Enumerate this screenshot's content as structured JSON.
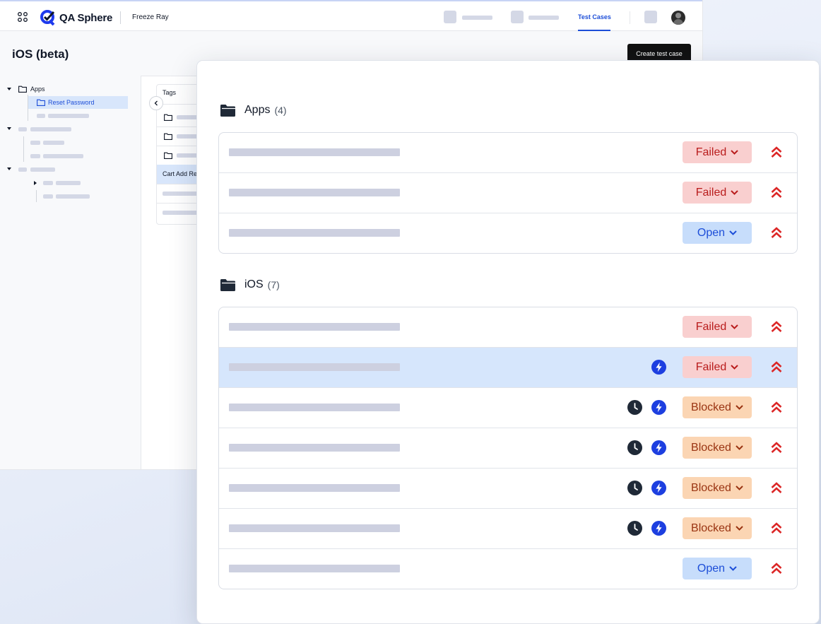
{
  "app": {
    "logo_text": "QA Sphere",
    "project_name": "Freeze Ray",
    "nav_active": "Test Cases",
    "page_title": "iOS (beta)",
    "create_button": "Create test case"
  },
  "sidebar": {
    "root_folder": "Apps",
    "selected_folder": "Reset Password"
  },
  "mid_panel": {
    "tab": "Tags",
    "row_text": "Cart Add Re"
  },
  "groups": [
    {
      "name": "Apps",
      "count": "(4)",
      "rows": [
        {
          "status": "Failed",
          "kind": "failed",
          "clock": false,
          "bolt": false,
          "highlight": false
        },
        {
          "status": "Failed",
          "kind": "failed",
          "clock": false,
          "bolt": false,
          "highlight": false
        },
        {
          "status": "Open",
          "kind": "open",
          "clock": false,
          "bolt": false,
          "highlight": false
        }
      ]
    },
    {
      "name": "iOS",
      "count": "(7)",
      "rows": [
        {
          "status": "Failed",
          "kind": "failed",
          "clock": false,
          "bolt": false,
          "highlight": false
        },
        {
          "status": "Failed",
          "kind": "failed",
          "clock": false,
          "bolt": true,
          "highlight": true
        },
        {
          "status": "Blocked",
          "kind": "blocked",
          "clock": true,
          "bolt": true,
          "highlight": false
        },
        {
          "status": "Blocked",
          "kind": "blocked",
          "clock": true,
          "bolt": true,
          "highlight": false
        },
        {
          "status": "Blocked",
          "kind": "blocked",
          "clock": true,
          "bolt": true,
          "highlight": false
        },
        {
          "status": "Blocked",
          "kind": "blocked",
          "clock": true,
          "bolt": true,
          "highlight": false
        },
        {
          "status": "Open",
          "kind": "open",
          "clock": false,
          "bolt": false,
          "highlight": false
        }
      ]
    }
  ],
  "icons": {
    "folder": "folder-icon",
    "clock": "clock-icon",
    "bolt": "lightning-icon",
    "priority": "priority-high-icon",
    "chevron": "chevron-down-icon"
  },
  "colors": {
    "failed_bg": "#f9cfcf",
    "failed_text": "#b91c1c",
    "blocked_bg": "#fbd5b3",
    "blocked_text": "#9a3412",
    "open_bg": "#c7ddfb",
    "open_text": "#1d4ed8",
    "accent": "#1d4ed8",
    "priority": "#dc2626",
    "highlight_row": "#d6e6fc"
  }
}
